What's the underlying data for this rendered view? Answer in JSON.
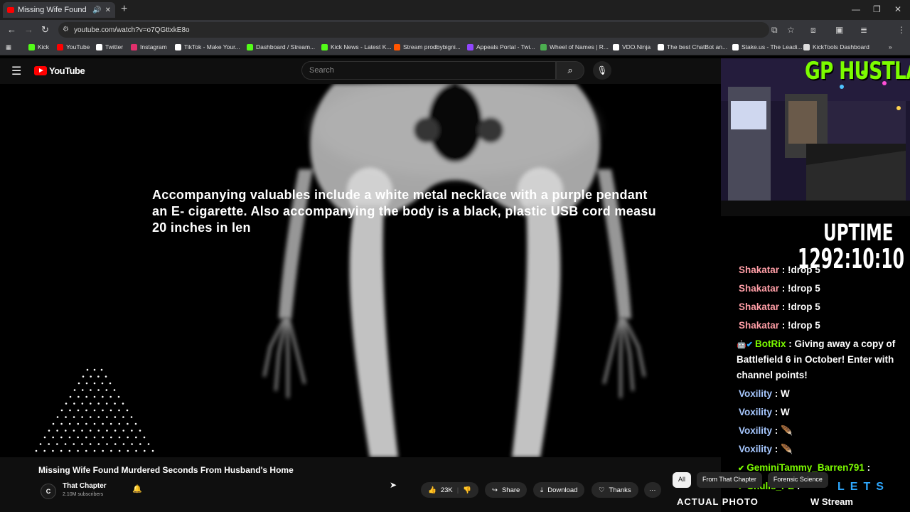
{
  "browser": {
    "tab_title": "Missing Wife Found Murde",
    "url": "youtube.com/watch?v=o7QGttxkE8o",
    "bookmarks": [
      {
        "label": "Kick",
        "color": "#53fc18"
      },
      {
        "label": "YouTube",
        "color": "#ff0000"
      },
      {
        "label": "Twitter",
        "color": "#ffffff"
      },
      {
        "label": "Instagram",
        "color": "#e1306c"
      },
      {
        "label": "TikTok - Make Your...",
        "color": "#ffffff"
      },
      {
        "label": "Dashboard / Stream...",
        "color": "#53fc18"
      },
      {
        "label": "Kick News - Latest K...",
        "color": "#53fc18"
      },
      {
        "label": "Stream prodbybigni...",
        "color": "#ff5500"
      },
      {
        "label": "Appeals Portal - Twi...",
        "color": "#9146ff"
      },
      {
        "label": "Wheel of Names | R...",
        "color": "#4caf50"
      },
      {
        "label": "VDO.Ninja",
        "color": "#ffffff"
      },
      {
        "label": "The best ChatBot an...",
        "color": "#ffffff"
      },
      {
        "label": "Stake.us - The Leadi...",
        "color": "#ffffff"
      },
      {
        "label": "KickTools Dashboard",
        "color": "#dddddd"
      }
    ]
  },
  "youtube": {
    "logo_text": "YouTube",
    "search_placeholder": "Search",
    "caption": "Accompanying valuables include a white metal necklace with a purple pendant\nan E- cigarette. Also accompanying the body is a black, plastic USB cord measu\n20 inches in len",
    "video_title": "Missing Wife Found Murdered Seconds From Husband's Home",
    "channel_name": "That Chapter",
    "channel_initial": "C",
    "channel_subs": "2.10M subscribers",
    "actions": {
      "likes": "23K",
      "share": "Share",
      "download": "Download",
      "thanks": "Thanks",
      "more": "···"
    },
    "chips": [
      "All",
      "From That Chapter",
      "Forensic Science"
    ]
  },
  "overlay": {
    "brand": "GP HUSTLA",
    "uptime_label": "UPTIME",
    "uptime_value": "1292:10:10",
    "chat": [
      {
        "user": "Shakatar",
        "text": " : !drop 5",
        "color": "#ff9ea6"
      },
      {
        "user": "Shakatar",
        "text": " : !drop 5",
        "color": "#ff9ea6"
      },
      {
        "user": "Shakatar",
        "text": " : !drop 5",
        "color": "#ff9ea6"
      },
      {
        "user": "Shakatar",
        "text": " : !drop 5",
        "color": "#ff9ea6"
      },
      {
        "user": "BotRix",
        "text": " : Giving away a copy of",
        "color": "#7CFC00"
      },
      {
        "user": "",
        "text": "Battlefield 6 in October! Enter with",
        "color": "#ffffff"
      },
      {
        "user": "",
        "text": "channel points!",
        "color": "#ffffff"
      },
      {
        "user": "Voxility",
        "text": " : W",
        "color": "#a7c8ff"
      },
      {
        "user": "Voxility",
        "text": " : W",
        "color": "#a7c8ff"
      },
      {
        "user": "Voxility",
        "text": " : ",
        "color": "#a7c8ff"
      },
      {
        "user": "Voxility",
        "text": " : ",
        "color": "#a7c8ff"
      },
      {
        "user": "GeminiTammy_Barren791",
        "text": " :",
        "color": "#7CFC00"
      },
      {
        "user": "Chulls_PE",
        "text": " :",
        "color": "#7CFC00"
      }
    ],
    "actual_photo": "ACTUAL PHOTO",
    "wstream": "W Stream",
    "lets": "LETS"
  }
}
